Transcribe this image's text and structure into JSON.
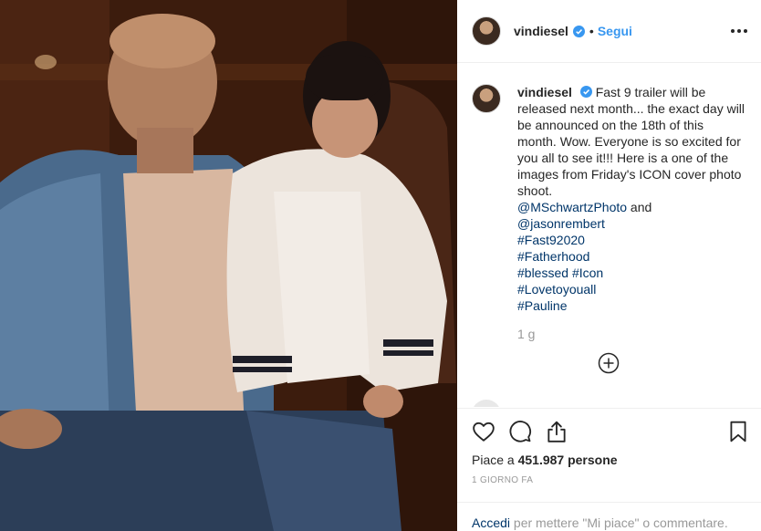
{
  "post": {
    "photo_alt": "post-photo"
  },
  "header": {
    "username": "vindiesel",
    "separator": "•",
    "follow_label": "Segui"
  },
  "caption": {
    "username": "vindiesel",
    "text": "Fast 9 trailer will be released next month... the exact day will be announced on the 18th of this month. Wow. Everyone is so excited for you all to see it!!! Here is a one of the images from Friday's ICON cover photo shoot.",
    "mention1": "@MSchwartzPhoto",
    "and_word": " and",
    "mention2": "@jasonrembert",
    "tags": {
      "t1": "#Fast92020",
      "t2": "#Fatherhood",
      "t3": "#blessed",
      "t4": "#Icon",
      "t5": "#Lovetoyouall",
      "t6": "#Pauline"
    },
    "age": "1 g"
  },
  "actions": {
    "icons": [
      "heart-icon",
      "comment-icon",
      "share-icon",
      "bookmark-icon"
    ],
    "likes_prefix": "Piace a ",
    "likes_count": "451.987 persone",
    "date": "1 GIORNO FA"
  },
  "login": {
    "link": "Accedi",
    "rest": " per mettere \"Mi piace\" o commentare."
  },
  "colors": {
    "link_blue": "#3897f0",
    "hashtag_dark_blue": "#003569",
    "muted": "#999999"
  }
}
